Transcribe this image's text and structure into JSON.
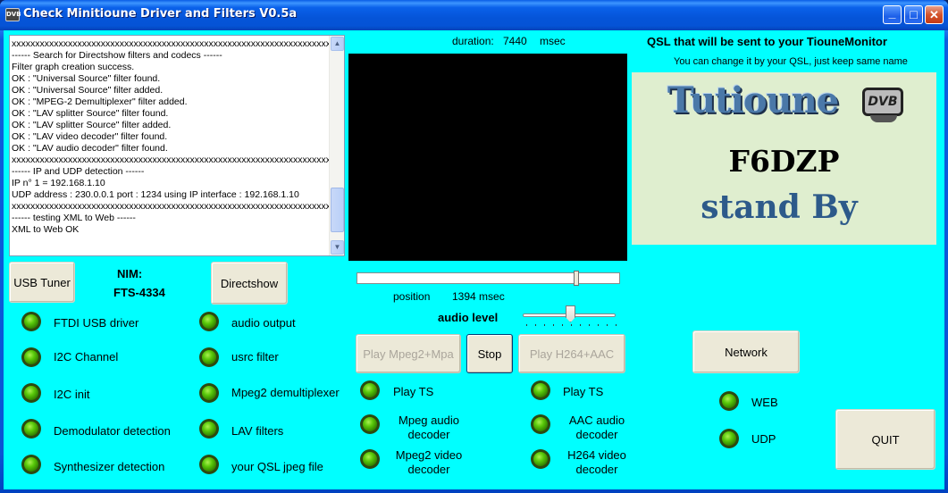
{
  "window": {
    "title": "Check Minitioune Driver and Filters V0.5a",
    "icon": "app-icon",
    "icon_text": "DVB",
    "controls": {
      "minimize": "_",
      "maximize": "□",
      "close": "✕"
    }
  },
  "log": {
    "lines": [
      "xxxxxxxxxxxxxxxxxxxxxxxxxxxxxxxxxxxxxxxxxxxxxxxxxxxxxxxxxxxxxxxxxxxxxxxxxxxx",
      "------ Search for Directshow filters and codecs ------",
      "Filter graph creation success.",
      "OK : \"Universal Source\" filter found.",
      "OK : \"Universal Source\" filter added.",
      "OK : \"MPEG-2 Demultiplexer\" filter added.",
      "OK : \"LAV splitter Source\" filter found.",
      "OK : \"LAV splitter Source\" filter added.",
      "OK : \"LAV video decoder\" filter found.",
      "OK : \"LAV audio decoder\" filter found.",
      "xxxxxxxxxxxxxxxxxxxxxxxxxxxxxxxxxxxxxxxxxxxxxxxxxxxxxxxxxxxxxxxxxxxxxxxxxxxx",
      "------ IP and UDP detection ------",
      "IP n° 1 = 192.168.1.10",
      "UDP address : 230.0.0.1 port : 1234 using IP interface : 192.168.1.10",
      "xxxxxxxxxxxxxxxxxxxxxxxxxxxxxxxxxxxxxxxxxxxxxxxxxxxxxxxxxxxxxxxxxxxxxxxxxxxx",
      "------ testing XML to Web ------",
      "XML to Web OK"
    ]
  },
  "buttons": {
    "usb_tuner": "USB Tuner",
    "directshow": "Directshow",
    "play_mpeg2": "Play Mpeg2+Mpa",
    "stop": "Stop",
    "play_h264": "Play H264+AAC",
    "network": "Network",
    "quit": "QUIT"
  },
  "nim": {
    "label": "NIM:",
    "value": "FTS-4334"
  },
  "status_left": [
    "FTDI USB driver",
    "I2C Channel",
    "I2C init",
    "Demodulator detection",
    "Synthesizer detection"
  ],
  "status_mid": [
    "audio output",
    "usrc filter",
    "Mpeg2 demultiplexer",
    "LAV filters",
    "your QSL jpeg file"
  ],
  "player": {
    "duration_label": "duration:",
    "duration_value": "7440",
    "duration_unit": "msec",
    "position_label": "position",
    "position_value": "1394 msec",
    "position_fraction": 0.84,
    "audio_level_label": "audio level",
    "audio_level_fraction": 0.5
  },
  "mpeg_leds": {
    "play_ts": "Play TS",
    "audio": "Mpeg audio\ndecoder",
    "video": "Mpeg2 video\ndecoder"
  },
  "h264_leds": {
    "play_ts": "Play TS",
    "audio": "AAC audio\ndecoder",
    "video": "H264 video\ndecoder"
  },
  "network_leds": {
    "web": "WEB",
    "udp": "UDP"
  },
  "qsl": {
    "heading": "QSL that will be sent to your TiouneMonitor",
    "hint": "You can change it by your QSL, just keep same name",
    "logo_text": "Tutioune",
    "dvb_badge": "DVB",
    "callsign": "F6DZP",
    "status": "stand By"
  },
  "colors": {
    "client_bg": "#00ffff",
    "led_on": "#58c80a",
    "button_face": "#ece9d8"
  }
}
